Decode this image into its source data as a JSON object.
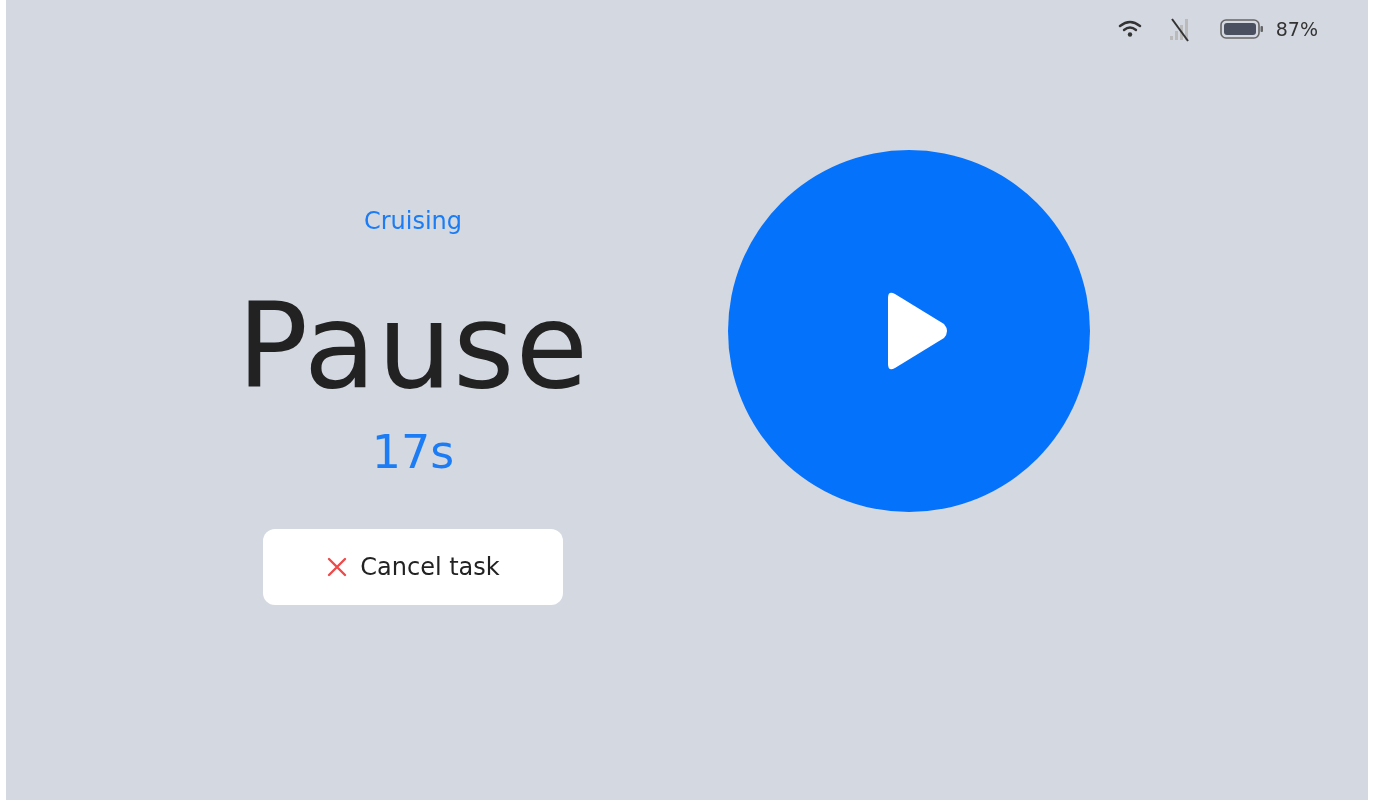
{
  "status_bar": {
    "cellular_connected": false,
    "battery": "87%"
  },
  "mode": "Cruising",
  "title": "Pause",
  "countdown": "17s",
  "cancel_button": {
    "label": "Cancel task"
  }
}
